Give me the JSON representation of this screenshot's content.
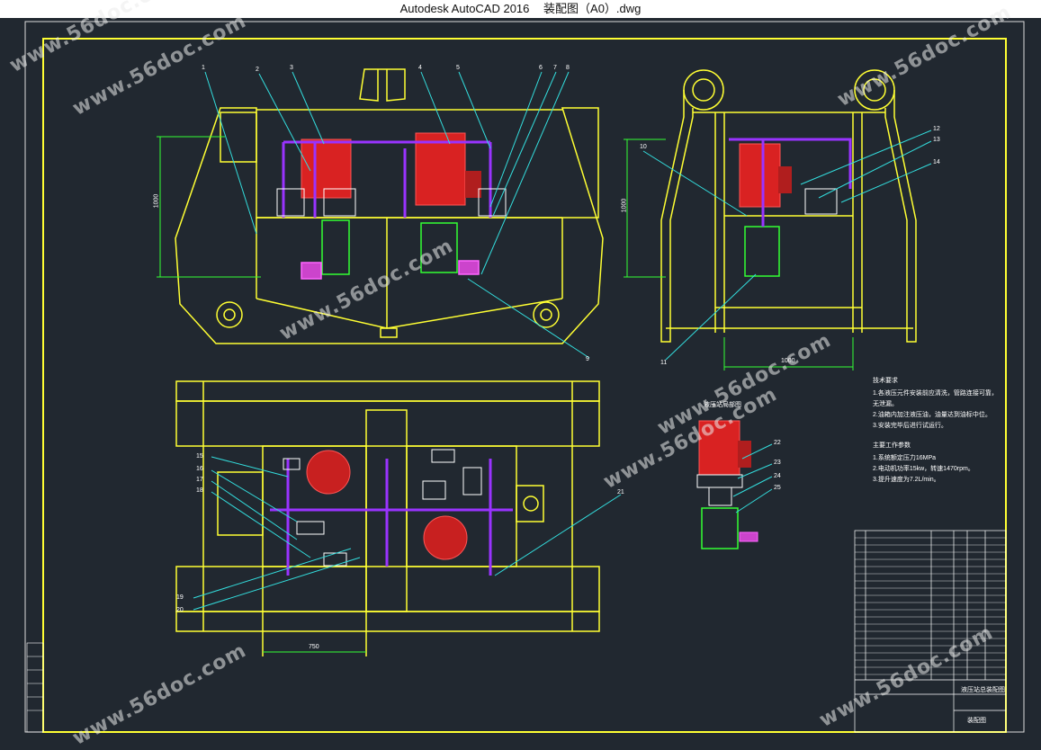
{
  "window": {
    "app": "Autodesk AutoCAD 2016",
    "file": "装配图（A0）.dwg"
  },
  "watermarks": [
    "www.56doc.com",
    "www.56doc.com",
    "www.56doc.com",
    "www.56doc.com",
    "www.56doc.com",
    "www.56doc.com",
    "www.56doc.com",
    "www.56doc.com"
  ],
  "views": {
    "front_height_dim": "1000",
    "side_height_dim": "1000",
    "side_width_dim": "1000",
    "plan_width_dim": "750"
  },
  "callouts": {
    "front": [
      "1",
      "2",
      "3",
      "4",
      "5",
      "6",
      "7",
      "8",
      "9"
    ],
    "side": [
      "10",
      "11",
      "12",
      "13",
      "14"
    ],
    "plan": [
      "15",
      "16",
      "17",
      "18",
      "19",
      "20",
      "21"
    ],
    "detail": [
      "22",
      "23",
      "24",
      "25"
    ]
  },
  "detail_title": "液压站局部图",
  "tech_requirements": {
    "title": "技术要求",
    "lines": [
      "1.各液压元件安装前应清洗，管路连接可靠，无泄漏。",
      "2.油箱内加注液压油，油量达到油标中位。",
      "3.安装完毕后进行试运行。"
    ]
  },
  "params": {
    "title": "主要工作参数",
    "lines": [
      "1.系统额定压力16MPa",
      "2.电动机功率15kw，转速1470rpm。",
      "3.提升速度为7.2L/min。"
    ]
  },
  "title_block": {
    "drawing_title": "液压站总装配图",
    "drawing_number": "装配图"
  },
  "colors": {
    "frame": "#ffff33",
    "motor": "#ff2a2a",
    "pipe": "#9933ff",
    "pump": "#33ff33",
    "leader": "#33dddd",
    "hatch": "#ff66ff"
  }
}
